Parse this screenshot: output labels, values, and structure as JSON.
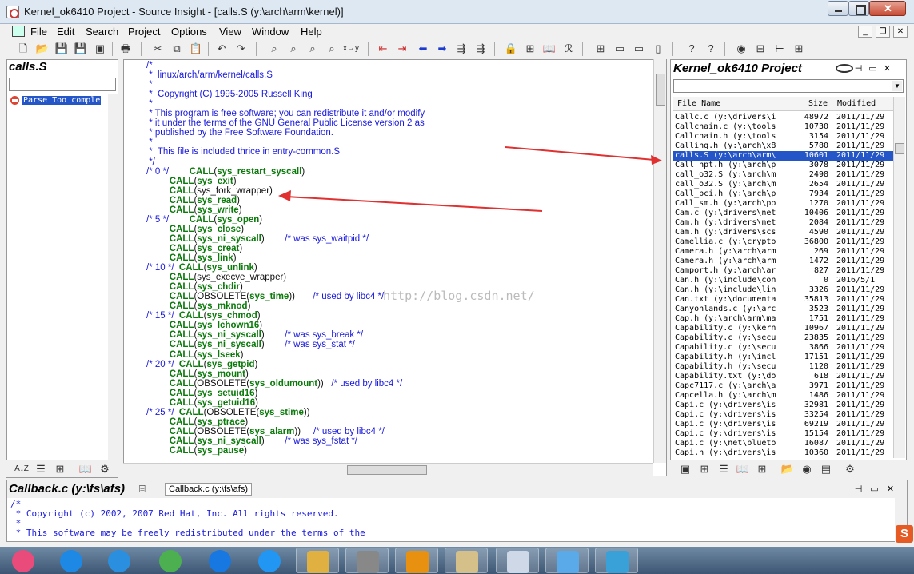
{
  "window": {
    "title": "Kernel_ok6410 Project - Source Insight - [calls.S (y:\\arch\\arm\\kernel)]"
  },
  "menu": [
    "File",
    "Edit",
    "Search",
    "Project",
    "Options",
    "View",
    "Window",
    "Help"
  ],
  "symbol_pane": {
    "title": "calls.S",
    "items": [
      {
        "label": "Parse Too comple",
        "icon": "error-icon"
      }
    ]
  },
  "editor": {
    "watermark": "http://blog.csdn.net/",
    "lines": [
      [
        [
          "cmt",
          "/*"
        ]
      ],
      [
        [
          "cmt",
          " *  linux/arch/arm/kernel/calls.S"
        ]
      ],
      [
        [
          "cmt",
          " *"
        ]
      ],
      [
        [
          "cmt",
          " *  Copyright (C) 1995-2005 Russell King"
        ]
      ],
      [
        [
          "cmt",
          " *"
        ]
      ],
      [
        [
          "cmt",
          " * This program is free software; you can redistribute it and/or modify"
        ]
      ],
      [
        [
          "cmt",
          " * it under the terms of the GNU General Public License version 2 as"
        ]
      ],
      [
        [
          "cmt",
          " * published by the Free Software Foundation."
        ]
      ],
      [
        [
          "cmt",
          " *"
        ]
      ],
      [
        [
          "cmt",
          " *  This file is included thrice in entry-common.S"
        ]
      ],
      [
        [
          "cmt",
          " */"
        ]
      ],
      [
        [
          "cmt",
          "/* 0 */"
        ],
        [
          "plain",
          "        "
        ],
        [
          "kw",
          "CALL"
        ],
        [
          "plain",
          "("
        ],
        [
          "kw",
          "sys_restart_syscall"
        ],
        [
          "plain",
          ")"
        ]
      ],
      [
        [
          "plain",
          "         "
        ],
        [
          "kw",
          "CALL"
        ],
        [
          "plain",
          "("
        ],
        [
          "kw",
          "sys_exit"
        ],
        [
          "plain",
          ")"
        ]
      ],
      [
        [
          "plain",
          "         "
        ],
        [
          "kw",
          "CALL"
        ],
        [
          "plain",
          "(sys_fork_wrapper)"
        ]
      ],
      [
        [
          "plain",
          "         "
        ],
        [
          "kw",
          "CALL"
        ],
        [
          "plain",
          "("
        ],
        [
          "kw",
          "sys_read"
        ],
        [
          "plain",
          ")"
        ]
      ],
      [
        [
          "plain",
          "         "
        ],
        [
          "kw",
          "CALL"
        ],
        [
          "plain",
          "("
        ],
        [
          "kw",
          "sys_write"
        ],
        [
          "plain",
          ")"
        ]
      ],
      [
        [
          "cmt",
          "/* 5 */"
        ],
        [
          "plain",
          "        "
        ],
        [
          "kw",
          "CALL"
        ],
        [
          "plain",
          "("
        ],
        [
          "kw",
          "sys_open"
        ],
        [
          "plain",
          ")"
        ]
      ],
      [
        [
          "plain",
          "         "
        ],
        [
          "kw",
          "CALL"
        ],
        [
          "plain",
          "("
        ],
        [
          "kw",
          "sys_close"
        ],
        [
          "plain",
          ")"
        ]
      ],
      [
        [
          "plain",
          "         "
        ],
        [
          "kw",
          "CALL"
        ],
        [
          "plain",
          "("
        ],
        [
          "kw",
          "sys_ni_syscall"
        ],
        [
          "plain",
          ")        "
        ],
        [
          "cmt",
          "/* was sys_waitpid */"
        ]
      ],
      [
        [
          "plain",
          "         "
        ],
        [
          "kw",
          "CALL"
        ],
        [
          "plain",
          "("
        ],
        [
          "kw",
          "sys_creat"
        ],
        [
          "plain",
          ")"
        ]
      ],
      [
        [
          "plain",
          "         "
        ],
        [
          "kw",
          "CALL"
        ],
        [
          "plain",
          "("
        ],
        [
          "kw",
          "sys_link"
        ],
        [
          "plain",
          ")"
        ]
      ],
      [
        [
          "cmt",
          "/* 10 */"
        ],
        [
          "plain",
          "  "
        ],
        [
          "kw",
          "CALL"
        ],
        [
          "plain",
          "("
        ],
        [
          "kw",
          "sys_unlink"
        ],
        [
          "plain",
          ")"
        ]
      ],
      [
        [
          "plain",
          "         "
        ],
        [
          "kw",
          "CALL"
        ],
        [
          "plain",
          "(sys_execve_wrapper)"
        ]
      ],
      [
        [
          "plain",
          "         "
        ],
        [
          "kw",
          "CALL"
        ],
        [
          "plain",
          "("
        ],
        [
          "kw",
          "sys_chdir"
        ],
        [
          "plain",
          ")"
        ]
      ],
      [
        [
          "plain",
          "         "
        ],
        [
          "kw",
          "CALL"
        ],
        [
          "plain",
          "(OBSOLETE("
        ],
        [
          "kw",
          "sys_time"
        ],
        [
          "plain",
          "))       "
        ],
        [
          "cmt",
          "/* used by libc4 */"
        ]
      ],
      [
        [
          "plain",
          "         "
        ],
        [
          "kw",
          "CALL"
        ],
        [
          "plain",
          "("
        ],
        [
          "kw",
          "sys_mknod"
        ],
        [
          "plain",
          ")"
        ]
      ],
      [
        [
          "cmt",
          "/* 15 */"
        ],
        [
          "plain",
          "  "
        ],
        [
          "kw",
          "CALL"
        ],
        [
          "plain",
          "("
        ],
        [
          "kw",
          "sys_chmod"
        ],
        [
          "plain",
          ")"
        ]
      ],
      [
        [
          "plain",
          "         "
        ],
        [
          "kw",
          "CALL"
        ],
        [
          "plain",
          "("
        ],
        [
          "kw",
          "sys_lchown16"
        ],
        [
          "plain",
          ")"
        ]
      ],
      [
        [
          "plain",
          "         "
        ],
        [
          "kw",
          "CALL"
        ],
        [
          "plain",
          "("
        ],
        [
          "kw",
          "sys_ni_syscall"
        ],
        [
          "plain",
          ")        "
        ],
        [
          "cmt",
          "/* was sys_break */"
        ]
      ],
      [
        [
          "plain",
          "         "
        ],
        [
          "kw",
          "CALL"
        ],
        [
          "plain",
          "("
        ],
        [
          "kw",
          "sys_ni_syscall"
        ],
        [
          "plain",
          ")        "
        ],
        [
          "cmt",
          "/* was sys_stat */"
        ]
      ],
      [
        [
          "plain",
          "         "
        ],
        [
          "kw",
          "CALL"
        ],
        [
          "plain",
          "("
        ],
        [
          "kw",
          "sys_lseek"
        ],
        [
          "plain",
          ")"
        ]
      ],
      [
        [
          "cmt",
          "/* 20 */"
        ],
        [
          "plain",
          "  "
        ],
        [
          "kw",
          "CALL"
        ],
        [
          "plain",
          "("
        ],
        [
          "kw",
          "sys_getpid"
        ],
        [
          "plain",
          ")"
        ]
      ],
      [
        [
          "plain",
          "         "
        ],
        [
          "kw",
          "CALL"
        ],
        [
          "plain",
          "("
        ],
        [
          "kw",
          "sys_mount"
        ],
        [
          "plain",
          ")"
        ]
      ],
      [
        [
          "plain",
          "         "
        ],
        [
          "kw",
          "CALL"
        ],
        [
          "plain",
          "(OBSOLETE("
        ],
        [
          "kw",
          "sys_oldumount"
        ],
        [
          "plain",
          "))   "
        ],
        [
          "cmt",
          "/* used by libc4 */"
        ]
      ],
      [
        [
          "plain",
          "         "
        ],
        [
          "kw",
          "CALL"
        ],
        [
          "plain",
          "("
        ],
        [
          "kw",
          "sys_setuid16"
        ],
        [
          "plain",
          ")"
        ]
      ],
      [
        [
          "plain",
          "         "
        ],
        [
          "kw",
          "CALL"
        ],
        [
          "plain",
          "("
        ],
        [
          "kw",
          "sys_getuid16"
        ],
        [
          "plain",
          ")"
        ]
      ],
      [
        [
          "cmt",
          "/* 25 */"
        ],
        [
          "plain",
          "  "
        ],
        [
          "kw",
          "CALL"
        ],
        [
          "plain",
          "(OBSOLETE("
        ],
        [
          "kw",
          "sys_stime"
        ],
        [
          "plain",
          "))"
        ]
      ],
      [
        [
          "plain",
          "         "
        ],
        [
          "kw",
          "CALL"
        ],
        [
          "plain",
          "("
        ],
        [
          "kw",
          "sys_ptrace"
        ],
        [
          "plain",
          ")"
        ]
      ],
      [
        [
          "plain",
          "         "
        ],
        [
          "kw",
          "CALL"
        ],
        [
          "plain",
          "(OBSOLETE("
        ],
        [
          "kw",
          "sys_alarm"
        ],
        [
          "plain",
          "))     "
        ],
        [
          "cmt",
          "/* used by libc4 */"
        ]
      ],
      [
        [
          "plain",
          "         "
        ],
        [
          "kw",
          "CALL"
        ],
        [
          "plain",
          "("
        ],
        [
          "kw",
          "sys_ni_syscall"
        ],
        [
          "plain",
          ")        "
        ],
        [
          "cmt",
          "/* was sys_fstat */"
        ]
      ],
      [
        [
          "plain",
          "         "
        ],
        [
          "kw",
          "CALL"
        ],
        [
          "plain",
          "("
        ],
        [
          "kw",
          "sys_pause"
        ],
        [
          "plain",
          ")"
        ]
      ]
    ]
  },
  "project_pane": {
    "title": "Kernel_ok6410 Project",
    "columns": {
      "name": "File Name",
      "size": "Size",
      "modified": "Modified"
    },
    "files": [
      {
        "name": "Callc.c (y:\\drivers\\i",
        "size": "48972",
        "modified": "2011/11/29"
      },
      {
        "name": "Callchain.c (y:\\tools",
        "size": "10730",
        "modified": "2011/11/29"
      },
      {
        "name": "Callchain.h (y:\\tools",
        "size": "3154",
        "modified": "2011/11/29"
      },
      {
        "name": "Calling.h (y:\\arch\\x8",
        "size": "5780",
        "modified": "2011/11/29"
      },
      {
        "name": "calls.S (y:\\arch\\arm\\",
        "size": "10601",
        "modified": "2011/11/29",
        "selected": true
      },
      {
        "name": "Call_hpt.h (y:\\arch\\p",
        "size": "3078",
        "modified": "2011/11/29"
      },
      {
        "name": "call_o32.S (y:\\arch\\m",
        "size": "2498",
        "modified": "2011/11/29"
      },
      {
        "name": "call_o32.S (y:\\arch\\m",
        "size": "2654",
        "modified": "2011/11/29"
      },
      {
        "name": "Call_pci.h (y:\\arch\\p",
        "size": "7934",
        "modified": "2011/11/29"
      },
      {
        "name": "Call_sm.h (y:\\arch\\po",
        "size": "1270",
        "modified": "2011/11/29"
      },
      {
        "name": "Cam.c (y:\\drivers\\net",
        "size": "10406",
        "modified": "2011/11/29"
      },
      {
        "name": "Cam.h (y:\\drivers\\net",
        "size": "2084",
        "modified": "2011/11/29"
      },
      {
        "name": "Cam.h (y:\\drivers\\scs",
        "size": "4590",
        "modified": "2011/11/29"
      },
      {
        "name": "Camellia.c (y:\\crypto",
        "size": "36800",
        "modified": "2011/11/29"
      },
      {
        "name": "Camera.h (y:\\arch\\arm",
        "size": "269",
        "modified": "2011/11/29"
      },
      {
        "name": "Camera.h (y:\\arch\\arm",
        "size": "1472",
        "modified": "2011/11/29"
      },
      {
        "name": "Camport.h (y:\\arch\\ar",
        "size": "827",
        "modified": "2011/11/29"
      },
      {
        "name": "Can.h (y:\\include\\con",
        "size": "0",
        "modified": "2016/5/1"
      },
      {
        "name": "Can.h (y:\\include\\lin",
        "size": "3326",
        "modified": "2011/11/29"
      },
      {
        "name": "Can.txt (y:\\documenta",
        "size": "35813",
        "modified": "2011/11/29"
      },
      {
        "name": "Canyonlands.c (y:\\arc",
        "size": "3523",
        "modified": "2011/11/29"
      },
      {
        "name": "Cap.h (y:\\arch\\arm\\ma",
        "size": "1751",
        "modified": "2011/11/29"
      },
      {
        "name": "Capability.c (y:\\kern",
        "size": "10967",
        "modified": "2011/11/29"
      },
      {
        "name": "Capability.c (y:\\secu",
        "size": "23835",
        "modified": "2011/11/29"
      },
      {
        "name": "Capability.c (y:\\secu",
        "size": "3866",
        "modified": "2011/11/29"
      },
      {
        "name": "Capability.h (y:\\incl",
        "size": "17151",
        "modified": "2011/11/29"
      },
      {
        "name": "Capability.h (y:\\secu",
        "size": "1120",
        "modified": "2011/11/29"
      },
      {
        "name": "Capability.txt (y:\\do",
        "size": "618",
        "modified": "2011/11/29"
      },
      {
        "name": "Capc7117.c (y:\\arch\\a",
        "size": "3971",
        "modified": "2011/11/29"
      },
      {
        "name": "Capcella.h (y:\\arch\\m",
        "size": "1486",
        "modified": "2011/11/29"
      },
      {
        "name": "Capi.c (y:\\drivers\\is",
        "size": "32981",
        "modified": "2011/11/29"
      },
      {
        "name": "Capi.c (y:\\drivers\\is",
        "size": "33254",
        "modified": "2011/11/29"
      },
      {
        "name": "Capi.c (y:\\drivers\\is",
        "size": "69219",
        "modified": "2011/11/29"
      },
      {
        "name": "Capi.c (y:\\drivers\\is",
        "size": "15154",
        "modified": "2011/11/29"
      },
      {
        "name": "Capi.c (y:\\net\\blueto",
        "size": "16087",
        "modified": "2011/11/29"
      },
      {
        "name": "Capi.h (y:\\drivers\\is",
        "size": "10360",
        "modified": "2011/11/29"
      }
    ]
  },
  "context_pane": {
    "title": "Callback.c (y:\\fs\\afs)",
    "tab": "Callback.c (y:\\fs\\afs)",
    "lines": [
      "/*",
      " * Copyright (c) 2002, 2007 Red Hat, Inc. All rights reserved.",
      " *",
      " * This software may be freely redistributed under the terms of the"
    ]
  },
  "taskbar": {
    "apps": [
      {
        "icon": "pinwheel-icon",
        "color": "#e94b7a"
      },
      {
        "icon": "baidu-cloud-icon",
        "color": "#1e88e5"
      },
      {
        "icon": "app-store-icon",
        "color": "#2b8fe0"
      },
      {
        "icon": "browser-icon",
        "color": "#4caf50"
      },
      {
        "icon": "kugou-icon",
        "color": "#1678e0"
      },
      {
        "icon": "wps-icon",
        "color": "#2196f3"
      },
      {
        "icon": "folder-icon",
        "color": "#e0b040"
      },
      {
        "icon": "media-icon",
        "color": "#888"
      },
      {
        "icon": "vm-icon",
        "color": "#e89010"
      },
      {
        "icon": "notepad-icon",
        "color": "#d6c08a"
      },
      {
        "icon": "source-insight-icon",
        "color": "#cfd8e6"
      },
      {
        "icon": "qq-icon",
        "color": "#5aa9e8"
      },
      {
        "icon": "recorder-icon",
        "color": "#3aa0d8"
      }
    ]
  }
}
